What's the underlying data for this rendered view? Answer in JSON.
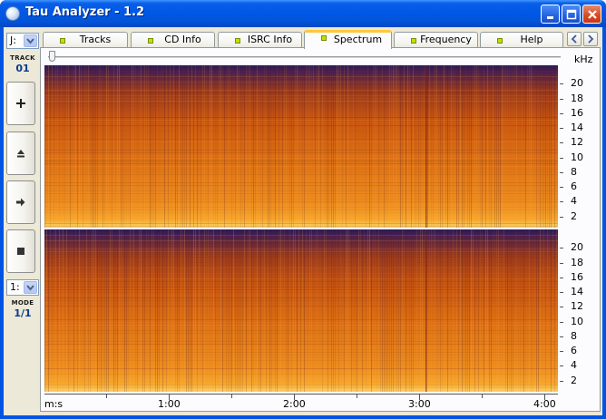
{
  "window": {
    "title": "Tau Analyzer - 1.2",
    "minimize_icon": "minimize-icon",
    "maximize_icon": "maximize-icon",
    "close_icon": "close-icon"
  },
  "sidebar": {
    "drive": "J:",
    "track_caption": "TRACK",
    "track_value": "01",
    "buttons": [
      {
        "name": "add-button",
        "icon": "plus-icon"
      },
      {
        "name": "eject-button",
        "icon": "eject-icon"
      },
      {
        "name": "play-button",
        "icon": "play-arrow-icon"
      },
      {
        "name": "stop-button",
        "icon": "stop-icon"
      }
    ],
    "mode_select": "1:",
    "mode_caption": "MODE",
    "mode_value": "1/1"
  },
  "tabs": [
    {
      "label": "Tracks",
      "active": false
    },
    {
      "label": "CD Info",
      "active": false
    },
    {
      "label": "ISRC Info",
      "active": false
    },
    {
      "label": "Spectrum",
      "active": true
    },
    {
      "label": "Frequency",
      "active": false
    },
    {
      "label": "Help",
      "active": false
    }
  ],
  "spectrum": {
    "unit_label": "kHz",
    "y_ticks": [
      "20",
      "18",
      "16",
      "14",
      "12",
      "10",
      "8",
      "6",
      "4",
      "2"
    ],
    "x_axis_label": "m:s",
    "x_ticks": [
      "1:00",
      "2:00",
      "3:00",
      "4:00"
    ]
  },
  "colors": {
    "title_bar": "#0058e6",
    "led": "#c2e000",
    "active_tab_accent": "#ffc83c",
    "spectrum_low": "#f7a228",
    "spectrum_mid": "#d2600e",
    "spectrum_high": "#2a1a5e"
  }
}
